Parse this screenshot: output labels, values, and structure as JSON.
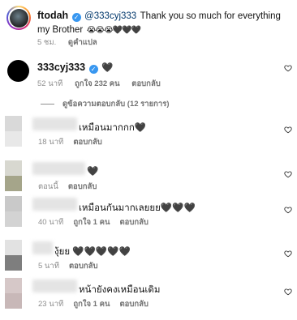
{
  "caption": {
    "username": "ftodah",
    "mention": "@333cyj333",
    "text": "Thank you so much for everything my Brother",
    "emojis": "😭😭😭🖤🖤🖤",
    "time": "5 ชม.",
    "translate": "ดูคำแปล"
  },
  "top_comment": {
    "username": "333cyj333",
    "text": "🖤",
    "time": "52 นาที",
    "likes": "ถูกใจ 232 คน",
    "reply": "ตอบกลับ"
  },
  "view_replies": "ดูข้อความตอบกลับ (12 รายการ)",
  "replies": [
    {
      "text": "เหมือนมากกก🖤",
      "time": "18 นาที",
      "likes": "",
      "reply": "ตอบกลับ"
    },
    {
      "text": "🖤",
      "time": "ตอนนี้",
      "likes": "",
      "reply": "ตอบกลับ"
    },
    {
      "text": "เหมือนกันมากเลยยย🖤🖤🖤",
      "time": "40 นาที",
      "likes": "ถูกใจ 1 คน",
      "reply": "ตอบกลับ"
    },
    {
      "text": "งุ้ยย 🖤🖤🖤🖤🖤",
      "time": "5 นาที",
      "likes": "",
      "reply": "ตอบกลับ"
    },
    {
      "text": "หน้ายังคงเหมือนเดิม",
      "time": "23 นาที",
      "likes": "ถูกใจ 1 คน",
      "reply": "ตอบกลับ"
    }
  ],
  "colors": {
    "verified": "#3897f0",
    "meta": "#8e8e8e",
    "text": "#111111"
  }
}
